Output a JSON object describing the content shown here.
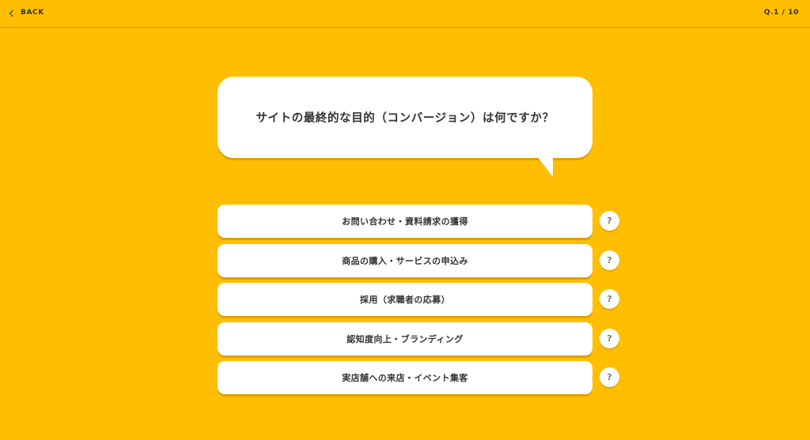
{
  "header": {
    "back_label": "BACK",
    "progress": "Q.1 / 10"
  },
  "question": {
    "text": "サイトの最終的な目的（コンバージョン）は何ですか？"
  },
  "options": [
    {
      "label": "お問い合わせ・資料請求の獲得",
      "help": "?"
    },
    {
      "label": "商品の購入・サービスの申込み",
      "help": "?"
    },
    {
      "label": "採用（求職者の応募）",
      "help": "?"
    },
    {
      "label": "認知度向上・ブランディング",
      "help": "?"
    },
    {
      "label": "実店舗への来店・イベント集客",
      "help": "?"
    }
  ],
  "colors": {
    "background": "#ffbe00",
    "card": "#ffffff",
    "text": "#333333"
  },
  "icons": {
    "back": "chevron-left-icon",
    "help": "question-mark-icon"
  }
}
